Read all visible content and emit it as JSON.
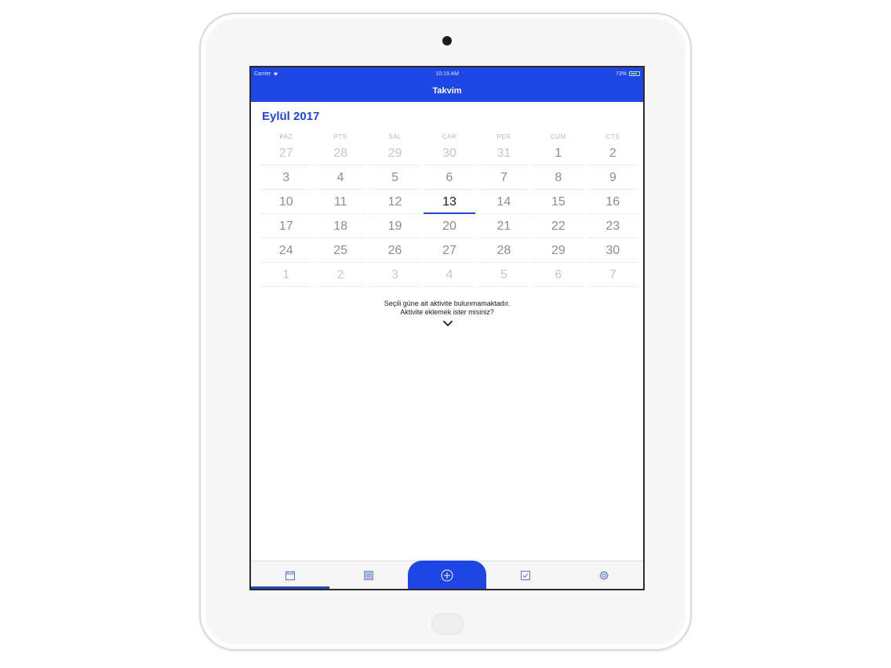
{
  "status_bar": {
    "carrier": "Carrier",
    "time": "10:19 AM",
    "battery": "73%"
  },
  "nav": {
    "title": "Takvim"
  },
  "calendar": {
    "month_title": "Eylül 2017",
    "weekdays": [
      "PAZ",
      "PTS",
      "SAL",
      "ÇAR",
      "PER",
      "CUM",
      "CTS"
    ],
    "weeks": [
      [
        {
          "d": "27",
          "o": true
        },
        {
          "d": "28",
          "o": true
        },
        {
          "d": "29",
          "o": true
        },
        {
          "d": "30",
          "o": true
        },
        {
          "d": "31",
          "o": true
        },
        {
          "d": "1"
        },
        {
          "d": "2"
        }
      ],
      [
        {
          "d": "3"
        },
        {
          "d": "4"
        },
        {
          "d": "5"
        },
        {
          "d": "6"
        },
        {
          "d": "7"
        },
        {
          "d": "8"
        },
        {
          "d": "9"
        }
      ],
      [
        {
          "d": "10"
        },
        {
          "d": "11"
        },
        {
          "d": "12"
        },
        {
          "d": "13",
          "s": true
        },
        {
          "d": "14"
        },
        {
          "d": "15"
        },
        {
          "d": "16"
        }
      ],
      [
        {
          "d": "17"
        },
        {
          "d": "18"
        },
        {
          "d": "19"
        },
        {
          "d": "20"
        },
        {
          "d": "21"
        },
        {
          "d": "22"
        },
        {
          "d": "23"
        }
      ],
      [
        {
          "d": "24"
        },
        {
          "d": "25"
        },
        {
          "d": "26"
        },
        {
          "d": "27"
        },
        {
          "d": "28"
        },
        {
          "d": "29"
        },
        {
          "d": "30"
        }
      ],
      [
        {
          "d": "1",
          "o": true
        },
        {
          "d": "2",
          "o": true
        },
        {
          "d": "3",
          "o": true
        },
        {
          "d": "4",
          "o": true
        },
        {
          "d": "5",
          "o": true
        },
        {
          "d": "6",
          "o": true
        },
        {
          "d": "7",
          "o": true
        }
      ]
    ]
  },
  "empty_state": {
    "line1": "Seçili güne ait aktivite bulunmamaktadır.",
    "line2": "Aktivite eklemek ister misiniz?"
  },
  "tabs": [
    {
      "name": "tab-calendar",
      "icon": "calendar-icon",
      "active": true
    },
    {
      "name": "tab-grid",
      "icon": "grid-icon"
    },
    {
      "name": "tab-add",
      "icon": "plus-circle-icon"
    },
    {
      "name": "tab-tasks",
      "icon": "checkbox-icon"
    },
    {
      "name": "tab-settings",
      "icon": "gear-icon"
    }
  ],
  "colors": {
    "accent": "#1d46e5",
    "text": "#8d8d93",
    "muted": "#c6c6cb"
  }
}
